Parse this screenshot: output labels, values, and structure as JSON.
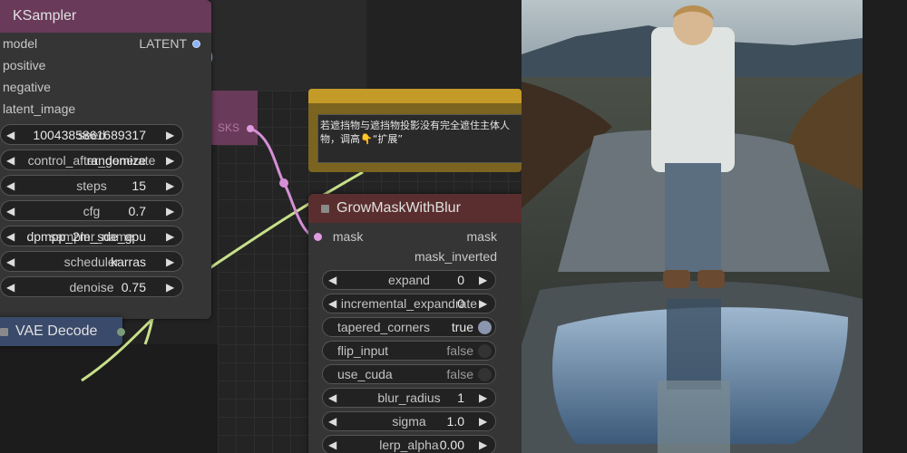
{
  "ksampler": {
    "title": "KSampler",
    "inputs": [
      "model",
      "positive",
      "negative",
      "latent_image"
    ],
    "output": "LATENT",
    "widgets": [
      {
        "label": "seed",
        "value": "1004385861689317"
      },
      {
        "label": "control_after_generate",
        "value": "randomize"
      },
      {
        "label": "steps",
        "value": "15"
      },
      {
        "label": "cfg",
        "value": "0.7"
      },
      {
        "label": "sampler_name",
        "value": "dpmpp_2m_sde_gpu"
      },
      {
        "label": "scheduler",
        "value": "karras"
      },
      {
        "label": "denoise",
        "value": "0.75"
      }
    ]
  },
  "vae_decode": {
    "title": "VAE Decode"
  },
  "masks_label": "SKS",
  "note": {
    "text": "若遮挡物与遮挡物投影没有完全遮住主体人物，调高👇“扩展”"
  },
  "grow": {
    "title": "GrowMaskWithBlur",
    "input": "mask",
    "outputs": [
      "mask",
      "mask_inverted"
    ],
    "widgets": [
      {
        "label": "expand",
        "value": "0",
        "kind": "num"
      },
      {
        "label": "incremental_expandrate",
        "value": "0",
        "kind": "num"
      },
      {
        "label": "tapered_corners",
        "value": "true",
        "kind": "toggle"
      },
      {
        "label": "flip_input",
        "value": "false",
        "kind": "toggle"
      },
      {
        "label": "use_cuda",
        "value": "false",
        "kind": "toggle"
      },
      {
        "label": "blur_radius",
        "value": "1",
        "kind": "num"
      },
      {
        "label": "sigma",
        "value": "1.0",
        "kind": "num"
      },
      {
        "label": "lerp_alpha",
        "value": "0.00",
        "kind": "num"
      }
    ]
  },
  "icons": {
    "arrow_left": "◀",
    "arrow_right": "▶"
  },
  "colors": {
    "ksampler_title": "#6a3a5a",
    "vae_title": "#3a4a6a",
    "grow_title": "#5a2e2e",
    "note": "#c49a28",
    "latent_dot": "#8ab4f8",
    "mask_dot": "#e09ae0",
    "wire_pink": "#d690d6",
    "wire_green": "#c8e08a"
  }
}
